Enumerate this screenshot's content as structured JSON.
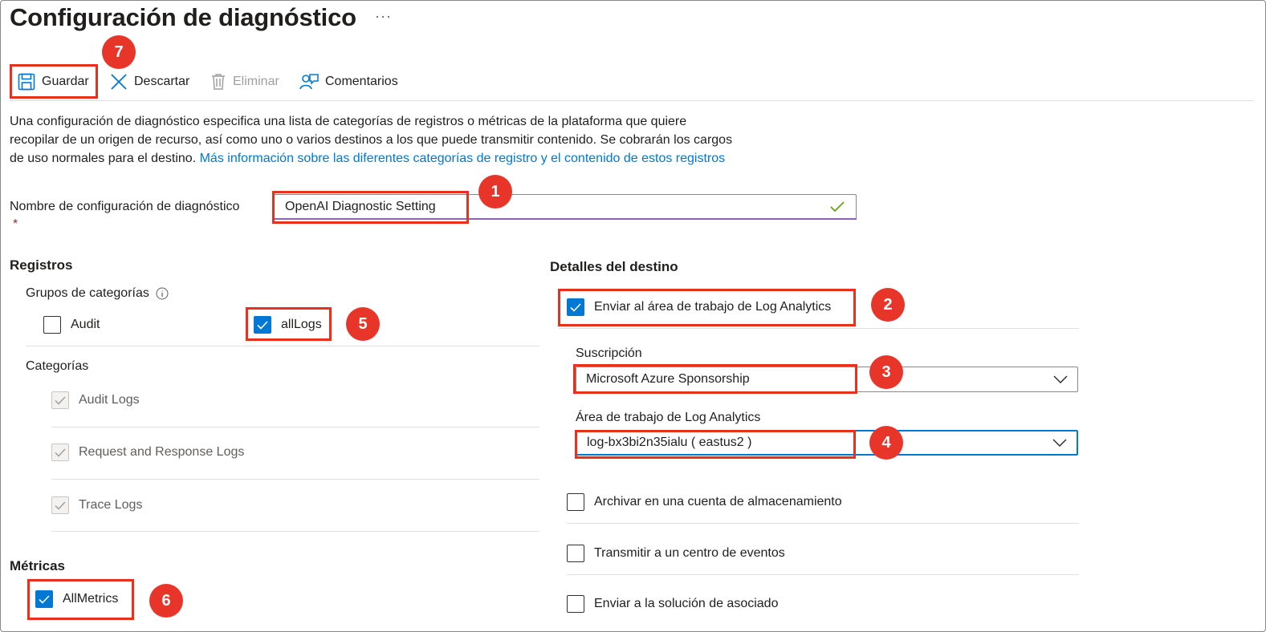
{
  "header": {
    "title": "Configuración de diagnóstico",
    "more_label": "···"
  },
  "toolbar": {
    "save_label": "Guardar",
    "discard_label": "Descartar",
    "delete_label": "Eliminar",
    "feedback_label": "Comentarios"
  },
  "description": {
    "text": "Una configuración de diagnóstico especifica una lista de categorías de registros o métricas de la plataforma que quiere recopilar de un origen de recurso, así como uno o varios destinos a los que puede transmitir contenido. Se cobrarán los cargos de uso normales para el destino. ",
    "link_text": "Más información sobre las diferentes categorías de registro y el contenido de estos registros"
  },
  "setting_name": {
    "label": "Nombre de configuración de diagnóstico",
    "required_marker": "*",
    "value": "OpenAI Diagnostic Setting"
  },
  "logs": {
    "heading": "Registros",
    "category_groups_label": "Grupos de categorías",
    "groups": [
      {
        "label": "Audit",
        "checked": false
      },
      {
        "label": "allLogs",
        "checked": true
      }
    ],
    "categories_label": "Categorías",
    "categories": [
      {
        "label": "Audit Logs",
        "checked": true,
        "disabled": true
      },
      {
        "label": "Request and Response Logs",
        "checked": true,
        "disabled": true
      },
      {
        "label": "Trace Logs",
        "checked": true,
        "disabled": true
      }
    ]
  },
  "metrics": {
    "heading": "Métricas",
    "items": [
      {
        "label": "AllMetrics",
        "checked": true
      }
    ]
  },
  "destination": {
    "heading": "Detalles del destino",
    "log_analytics": {
      "label": "Enviar al área de trabajo de Log Analytics",
      "checked": true
    },
    "subscription": {
      "label": "Suscripción",
      "value": "Microsoft Azure Sponsorship"
    },
    "workspace": {
      "label": "Área de trabajo de Log Analytics",
      "value": "log-bx3bi2n35ialu ( eastus2 )"
    },
    "options": [
      {
        "label": "Archivar en una cuenta de almacenamiento",
        "checked": false
      },
      {
        "label": "Transmitir a un centro de eventos",
        "checked": false
      },
      {
        "label": "Enviar a la solución de asociado",
        "checked": false
      }
    ]
  },
  "annotations": [
    "1",
    "2",
    "3",
    "4",
    "5",
    "6",
    "7"
  ],
  "colors": {
    "accent": "#0078d4",
    "annotation_red": "#e8301c",
    "valid_check": "#57a300"
  }
}
